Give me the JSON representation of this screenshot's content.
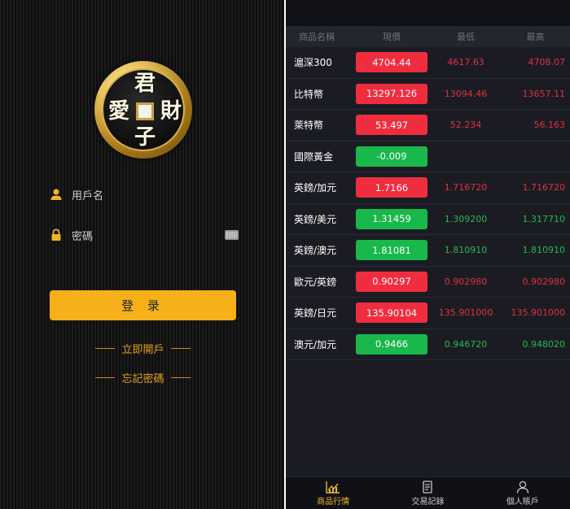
{
  "login": {
    "logo": {
      "top_char": "君",
      "left_char": "愛",
      "right_char": "財",
      "bottom_char": "子"
    },
    "username_placeholder": "用戶名",
    "password_placeholder": "密碼",
    "login_button": "登 录",
    "open_account_link": "立即開戶",
    "forgot_password_link": "忘記密碼",
    "accent_color": "#f5b01a"
  },
  "market": {
    "headers": {
      "name": "商品名稱",
      "price": "現價",
      "low": "最低",
      "high": "最高"
    },
    "colors": {
      "up": "#ef2d3e",
      "down": "#18b84a",
      "up_text": "#e0303f",
      "down_text": "#27b84d"
    },
    "rows": [
      {
        "name": "滬深300",
        "price": "4704.44",
        "low": "4617.63",
        "high": "4708.07",
        "trend": "up"
      },
      {
        "name": "比特幣",
        "price": "13297.126",
        "low": "13094.46",
        "high": "13657.11",
        "trend": "up"
      },
      {
        "name": "萊特幣",
        "price": "53.497",
        "low": "52.234",
        "high": "56.163",
        "trend": "up"
      },
      {
        "name": "國際黃金",
        "price": "-0.009",
        "low": "",
        "high": "",
        "trend": "down"
      },
      {
        "name": "英鎊/加元",
        "price": "1.7166",
        "low": "1.716720",
        "high": "1.716720",
        "trend": "up"
      },
      {
        "name": "英鎊/美元",
        "price": "1.31459",
        "low": "1.309200",
        "high": "1.317710",
        "trend": "down"
      },
      {
        "name": "英鎊/澳元",
        "price": "1.81081",
        "low": "1.810910",
        "high": "1.810910",
        "trend": "down"
      },
      {
        "name": "歐元/英鎊",
        "price": "0.90297",
        "low": "0.902980",
        "high": "0.902980",
        "trend": "up"
      },
      {
        "name": "英鎊/日元",
        "price": "135.90104",
        "low": "135.901000",
        "high": "135.901000",
        "trend": "up"
      },
      {
        "name": "澳元/加元",
        "price": "0.9466",
        "low": "0.946720",
        "high": "0.948020",
        "trend": "down"
      }
    ],
    "tabs": [
      {
        "label": "商品行情",
        "icon": "chart-icon",
        "active": true
      },
      {
        "label": "交易記錄",
        "icon": "document-icon",
        "active": false
      },
      {
        "label": "個人賬戶",
        "icon": "user-icon",
        "active": false
      }
    ]
  }
}
